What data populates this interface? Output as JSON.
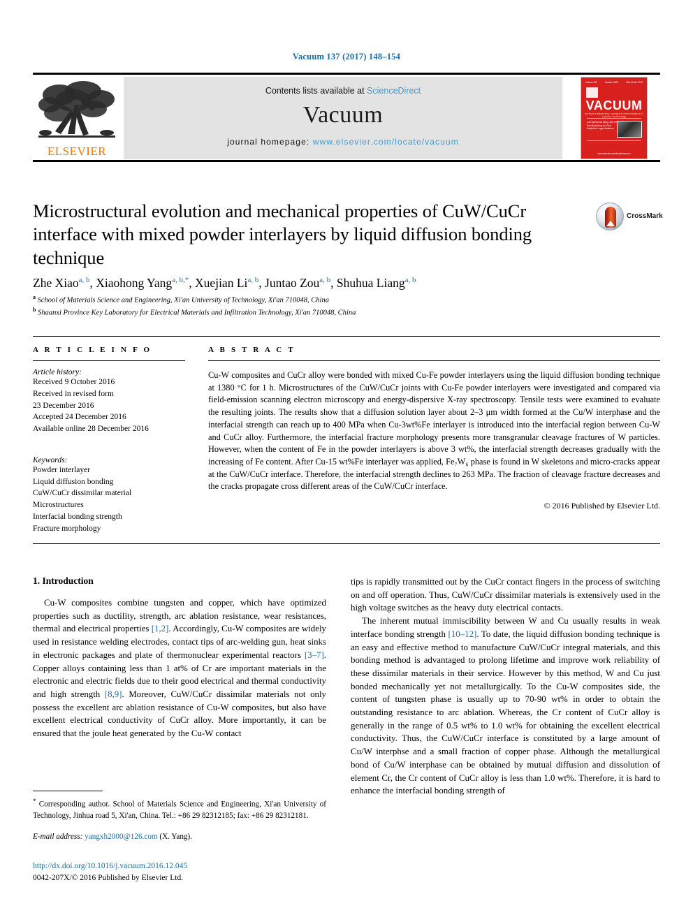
{
  "running_head": "Vacuum 137 (2017) 148–154",
  "masthead": {
    "contents_prefix": "Contents lists available at ",
    "sciencedirect": "ScienceDirect",
    "journal_name": "Vacuum",
    "homepage_label": "journal homepage: ",
    "homepage_url": "www.elsevier.com/locate/vacuum",
    "publisher_logo_text": "ELSEVIER",
    "cover": {
      "title": "VACUUM",
      "subtitle": "surface engineering, surface instrumentation & vacuum technology",
      "top_left": "Volume 000",
      "top_mid": "Number 0000",
      "top_right": "15th Month 2016",
      "names": "Editor-in-Chief\nEditor\nSpecial Issue Editor\nassociate Editors",
      "names2": "Jose Molina\nDa Wang\nJian-Ping Sun\nMing Song-Lin\nPaul Ampfelder\nLogan Anderson",
      "footer": "www.elsevier.com/locate/vacuum"
    }
  },
  "article": {
    "title": "Microstructural evolution and mechanical properties of CuW/CuCr interface with mixed powder interlayers by liquid diffusion bonding technique",
    "crossmark_label": "CrossMark",
    "authors": [
      {
        "name": "Zhe Xiao",
        "marks": "a, b",
        "corresponding": false
      },
      {
        "name": "Xiaohong Yang",
        "marks": "a, b",
        "corresponding": true
      },
      {
        "name": "Xuejian Li",
        "marks": "a, b",
        "corresponding": false
      },
      {
        "name": "Juntao Zou",
        "marks": "a, b",
        "corresponding": false
      },
      {
        "name": "Shuhua Liang",
        "marks": "a, b",
        "corresponding": false
      }
    ],
    "affiliations": [
      {
        "mark": "a",
        "text": "School of Materials Science and Engineering, Xi'an University of Technology, Xi'an 710048, China"
      },
      {
        "mark": "b",
        "text": "Shaanxi Province Key Laboratory for Electrical Materials and Infiltration Technology, Xi'an 710048, China"
      }
    ]
  },
  "article_info": {
    "heading": "A R T I C L E   I N F O",
    "history_label": "Article history:",
    "history": [
      "Received 9 October 2016",
      "Received in revised form",
      "23 December 2016",
      "Accepted 24 December 2016",
      "Available online 28 December 2016"
    ],
    "keywords_label": "Keywords:",
    "keywords": [
      "Powder interlayer",
      "Liquid diffusion bonding",
      "CuW/CuCr dissimilar material",
      "Microstructures",
      "Interfacial bonding strength",
      "Fracture morphology"
    ]
  },
  "abstract": {
    "heading": "A B S T R A C T",
    "text": "Cu-W composites and CuCr alloy were bonded with mixed Cu-Fe powder interlayers using the liquid diffusion bonding technique at 1380 °C for 1 h. Microstructures of the CuW/CuCr joints with Cu-Fe powder interlayers were investigated and compared via field-emission scanning electron microscopy and energy-dispersive X-ray spectroscopy. Tensile tests were examined to evaluate the resulting joints. The results show that a diffusion solution layer about 2–3 μm width formed at the Cu/W interphase and the interfacial strength can reach up to 400 MPa when Cu-3wt%Fe interlayer is introduced into the interfacial region between Cu-W and CuCr alloy. Furthermore, the interfacial fracture morphology presents more transgranular cleavage fractures of W particles. However, when the content of Fe in the powder interlayers is above 3 wt%, the interfacial strength decreases gradually with the increasing of Fe content. After Cu-15 wt%Fe interlayer was applied, Fe₇W₆ phase is found in W skeletons and micro-cracks appear at the CuW/CuCr interface. Therefore, the interfacial strength declines to 263 MPa. The fraction of cleavage fracture decreases and the cracks propagate cross different areas of the CuW/CuCr interface.",
    "copyright": "© 2016 Published by Elsevier Ltd."
  },
  "body": {
    "section_number_title": "1. Introduction",
    "left_p1_a": "Cu-W composites combine tungsten and copper, which have optimized properties such as ductility, strength, arc ablation resistance, wear resistances, thermal and electrical properties ",
    "left_p1_ref1": "[1,2]",
    "left_p1_b": ". Accordingly, Cu-W composites are widely used in resistance welding electrodes, contact tips of arc-welding gun, heat sinks in electronic packages and plate of thermonuclear experimental reactors ",
    "left_p1_ref2": "[3–7]",
    "left_p1_c": ". Copper alloys containing less than 1 at% of Cr are important materials in the electronic and electric fields due to their good electrical and thermal conductivity and high strength ",
    "left_p1_ref3": "[8,9]",
    "left_p1_d": ". Moreover, CuW/CuCr dissimilar materials not only possess the excellent arc ablation resistance of Cu-W composites, but also have excellent electrical conductivity of CuCr alloy. More importantly, it can be ensured that the joule heat generated by the Cu-W contact",
    "right_p1": "tips is rapidly transmitted out by the CuCr contact fingers in the process of switching on and off operation. Thus, CuW/CuCr dissimilar materials is extensively used in the high voltage switches as the heavy duty electrical contacts.",
    "right_p2_a": "The inherent mutual immiscibility between W and Cu usually results in weak interface bonding strength ",
    "right_p2_ref": "[10–12]",
    "right_p2_b": ". To date, the liquid diffusion bonding technique is an easy and effective method to manufacture CuW/CuCr integral materials, and this bonding method is advantaged to prolong lifetime and improve work reliability of these dissimilar materials in their service. However by this method, W and Cu just bonded mechanically yet not metallurgically. To the Cu-W composites side, the content of tungsten phase is usually up to 70-90 wt% in order to obtain the outstanding resistance to arc ablation. Whereas, the Cr content of CuCr alloy is generally in the range of 0.5 wt% to 1.0 wt% for obtaining the excellent electrical conductivity. Thus, the CuW/CuCr interface is constituted by a large amount of Cu/W interphse and a small fraction of copper phase. Although the metallurgical bond of Cu/W interphase can be obtained by mutual diffusion and dissolution of element Cr, the Cr content of CuCr alloy is less than 1.0 wt%. Therefore, it is hard to enhance the interfacial bonding strength of"
  },
  "footer": {
    "corresponding_note": "Corresponding author. School of Materials Science and Engineering, Xi'an University of Technology, Jinhua road 5, Xi'an, China. Tel.: +86 29 82312185; fax: +86 29 82312181.",
    "email_label": "E-mail address:",
    "email_address": "yangxh2000@126.com",
    "email_owner": "(X. Yang).",
    "doi": "http://dx.doi.org/10.1016/j.vacuum.2016.12.045",
    "issn_line": "0042-207X/© 2016 Published by Elsevier Ltd."
  },
  "colors": {
    "link_blue": "#1a6ba0",
    "sciencedirect_blue": "#3f9bd0",
    "elsevier_orange": "#ea7600",
    "cover_red": "#d8201f",
    "band_grey": "#e3e3e3"
  }
}
